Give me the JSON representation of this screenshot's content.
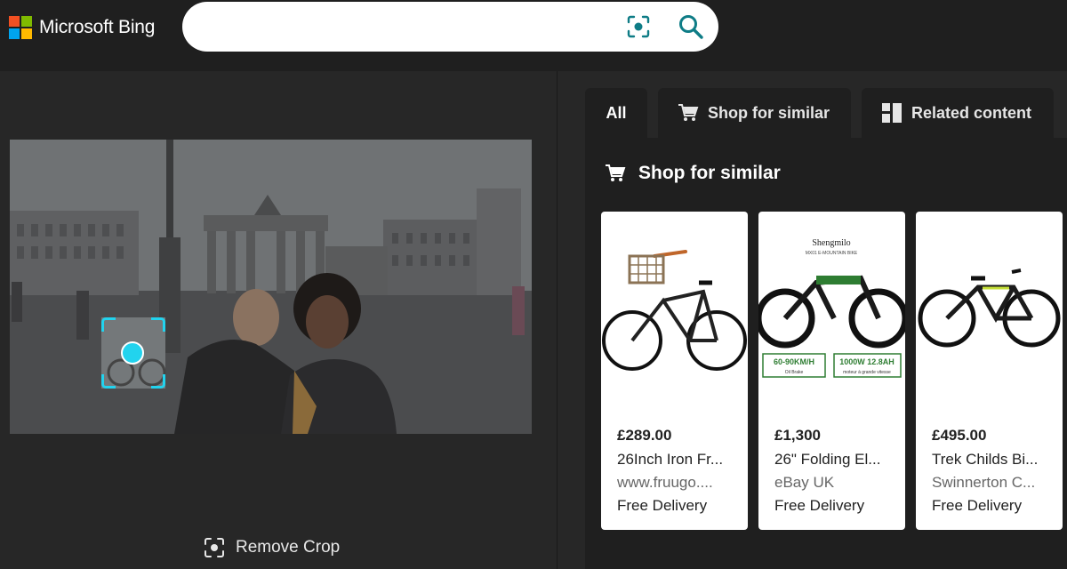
{
  "header": {
    "logo_text": "Microsoft Bing",
    "search_value": "",
    "search_placeholder": ""
  },
  "left": {
    "remove_crop_label": "Remove Crop"
  },
  "tabs": [
    {
      "label": "All",
      "icon": "none",
      "active": true
    },
    {
      "label": "Shop for similar",
      "icon": "cart-icon",
      "active": false
    },
    {
      "label": "Related content",
      "icon": "grid-icon",
      "active": false
    }
  ],
  "shop": {
    "title": "Shop for similar",
    "products": [
      {
        "price": "£289.00",
        "name": "26Inch Iron Fr...",
        "store": "www.fruugo....",
        "delivery": "Free Delivery"
      },
      {
        "price": "£1,300",
        "name": "26\" Folding El...",
        "store": "eBay UK",
        "delivery": "Free Delivery",
        "image_text": [
          "Shengmilo",
          "MX01 E-MOUNTAIN BIKE",
          "60-90KM/H",
          "1000W 12.8AH",
          "Oil Brake",
          "moteur à grande vitesse"
        ]
      },
      {
        "price": "£495.00",
        "name": "Trek Childs Bi...",
        "store": "Swinnerton C...",
        "delivery": "Free Delivery"
      }
    ]
  },
  "colors": {
    "accent": "#22d3ee",
    "brand_teal": "#0e7c86",
    "header_bg": "#1f1f1f",
    "page_bg": "#272727"
  }
}
